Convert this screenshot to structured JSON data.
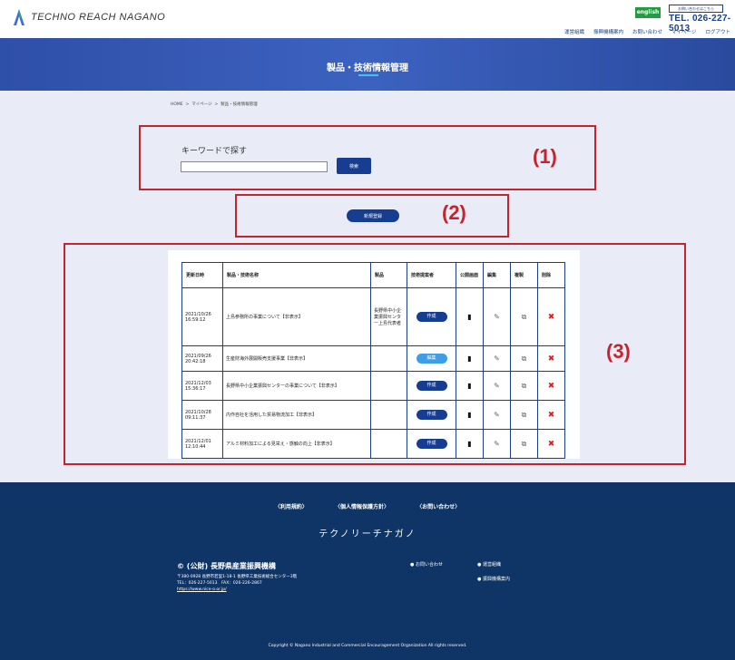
{
  "header": {
    "logo_text": "TECHNO REACH NAGANO",
    "english_label": "english",
    "contact_box_label": "お問い合わせはこちら",
    "tel": "TEL. 026-227-5013",
    "nav": [
      "運営組織",
      "振興機構案内",
      "お問い合わせ",
      "マイページ",
      "ログアウト"
    ]
  },
  "hero": {
    "title": "製品・技術情報管理"
  },
  "breadcrumb": {
    "items": [
      "HOME",
      ">",
      "マイページ",
      ">",
      "製品・技術情報管理"
    ]
  },
  "search": {
    "label": "キーワードで探す",
    "input_value": "",
    "button_label": "検索",
    "tag": "(1)"
  },
  "new_entry": {
    "button_label": "新規登録",
    "tag": "(2)"
  },
  "table": {
    "tag": "(3)",
    "headers": [
      "更新日時",
      "製品・技術名称",
      "製品",
      "技術提案者",
      "公開画面",
      "編集",
      "複製",
      "削除"
    ],
    "rows": [
      {
        "updated": "2021/10/26 16:59:12",
        "name": "上島参務所の事業について【非表示】",
        "org": "長野県中小企業振興センター上島代表者",
        "proposal": "作成",
        "light": false
      },
      {
        "updated": "2021/09/26 20:42:18",
        "name": "生産財海外展開販売支援事業【非表示】",
        "org": "",
        "proposal": "編集",
        "light": true
      },
      {
        "updated": "2021/12/03 15:36:17",
        "name": "長野県中小企業振興センターの事業について【非表示】",
        "org": "",
        "proposal": "作成",
        "light": false
      },
      {
        "updated": "2021/10/28 09:11:37",
        "name": "内作自社を活用した貿易物流加工【非表示】",
        "org": "",
        "proposal": "作成",
        "light": false
      },
      {
        "updated": "2021/12/01 12:10:44",
        "name": "アルミ材料加工による見栄え・感触の向上【非表示】",
        "org": "",
        "proposal": "作成",
        "light": false
      }
    ]
  },
  "footer": {
    "links": [
      "〈利用規約〉",
      "〈個人情報保護方針〉",
      "〈お問い合わせ〉"
    ],
    "brand": "テクノリーチナガノ",
    "org_name": "© (公財) 長野県産業振興機構",
    "address": "〒380-0928 長野市若里1-18-1 長野県工業技術総合センター3階",
    "contact_line": "TEL：026-227-5013　FAX：026-226-2867",
    "url": "https://www.nice-o.or.jp/",
    "nav_left": "● お問い合わせ",
    "nav_right_1": "● 運営組織",
    "nav_right_2": "● 振興機構案内",
    "copyright": "Copyright © Nagano Industrial and Commercial Encouragement Organization All rights reserved."
  },
  "colors": {
    "brand": "#163d8f",
    "hero": "#3c62c0",
    "annotation": "#c5232d",
    "footer": "#0f3567"
  }
}
